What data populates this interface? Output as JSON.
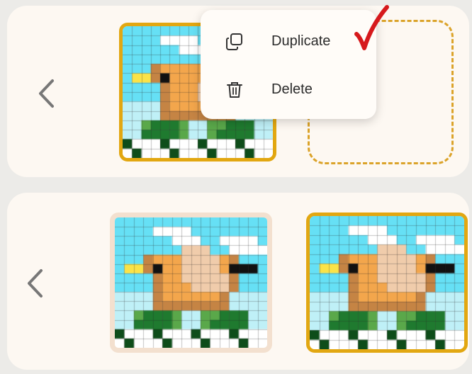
{
  "menu": {
    "duplicate_label": "Duplicate",
    "delete_label": "Delete"
  },
  "icons": {
    "back": "chevron-left-icon",
    "duplicate": "copy-icon",
    "delete": "trash-icon",
    "check": "checkmark-icon"
  },
  "colors": {
    "accent": "#e2a711",
    "check": "#d6191c",
    "panel": "#fdf8f2"
  }
}
